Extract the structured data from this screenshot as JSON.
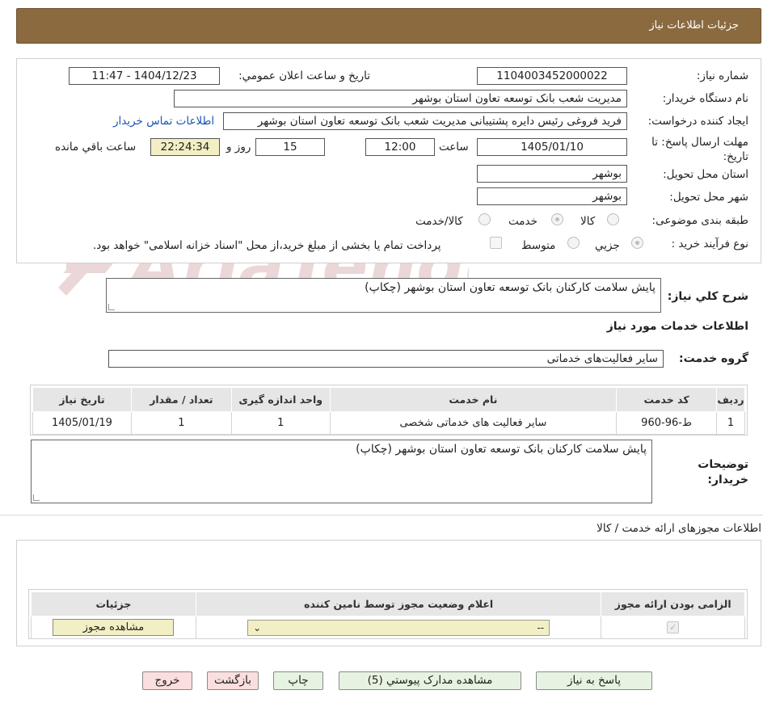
{
  "header": {
    "title": "جزئیات اطلاعات نیاز"
  },
  "form": {
    "need_number_label": "شماره نیاز:",
    "need_number": "1104003452000022",
    "announce_label": "تاریخ و ساعت اعلان عمومي:",
    "announce_value": "1404/12/23 - 11:47",
    "buyer_org_label": "نام دستگاه خریدار:",
    "buyer_org": "مدیریت شعب بانک توسعه تعاون استان بوشهر",
    "creator_label": "ایجاد کننده درخواست:",
    "creator": "فرید فروغی رئیس دایره پشتیبانی مدیریت شعب بانک توسعه تعاون استان بوشهر",
    "contact_link": "اطلاعات تماس خریدار",
    "deadline_label": "مهلت ارسال پاسخ: تا تاریخ:",
    "deadline_date": "1405/01/10",
    "time_label": "ساعت",
    "deadline_time": "12:00",
    "days_value": "15",
    "days_label": "روز و",
    "remaining_time": "22:24:34",
    "remaining_label": "ساعت باقي مانده",
    "province_label": "استان محل تحویل:",
    "province": "بوشهر",
    "city_label": "شهر محل تحویل:",
    "city": "بوشهر",
    "category_label": "طبقه بندی موضوعی:",
    "category_options": [
      "کالا",
      "خدمت",
      "کالا/خدمت"
    ],
    "category_selected": "خدمت",
    "process_label": "نوع فرآیند خرید :",
    "process_options": [
      "جزيي",
      "متوسط"
    ],
    "process_selected": "جزيي",
    "payment_note": "پرداخت تمام یا بخشی از مبلغ خرید،از محل \"اسناد خزانه اسلامی\" خواهد بود."
  },
  "description": {
    "label": "شرح کلي نیاز:",
    "text": "پایش سلامت کارکنان بانک توسعه تعاون استان بوشهر (چکاپ)"
  },
  "services": {
    "section_title": "اطلاعات خدمات مورد نیاز",
    "group_label": "گروه خدمت:",
    "group_value": "سایر فعالیت‌های خدماتی",
    "columns": [
      "ردیف",
      "کد خدمت",
      "نام خدمت",
      "واحد اندازه گیری",
      "تعداد / مقدار",
      "تاریخ نیاز"
    ],
    "rows": [
      {
        "index": "1",
        "code": "ط-96-960",
        "name": "سایر فعالیت های خدماتی شخصی",
        "unit": "1",
        "qty": "1",
        "date": "1405/01/19"
      }
    ]
  },
  "buyer_notes": {
    "label": "توضیحات خریدار:",
    "text": "پایش سلامت کارکنان بانک توسعه تعاون استان بوشهر (چکاپ)"
  },
  "permits": {
    "section_title": "اطلاعات مجوزهای ارائه خدمت / کالا",
    "columns": [
      "الزامی بودن ارائه مجوز",
      "اعلام وضعیت مجوز توسط نامین کننده",
      "جزئیات"
    ],
    "select_value": "--",
    "view_button": "مشاهده مجوز"
  },
  "buttons": {
    "reply": "پاسخ به نیاز",
    "attachments": "مشاهده مدارک پیوستي (5)",
    "print": "چاپ",
    "back": "بازگشت",
    "exit": "خروج"
  },
  "watermark": {
    "text": "AriaTender.neT"
  },
  "colors": {
    "header_bg": "#8B6A40",
    "link": "#1a55b8",
    "highlight": "#f2efc4",
    "button_green": "#e7f3e2",
    "button_pink": "#fbdede"
  }
}
